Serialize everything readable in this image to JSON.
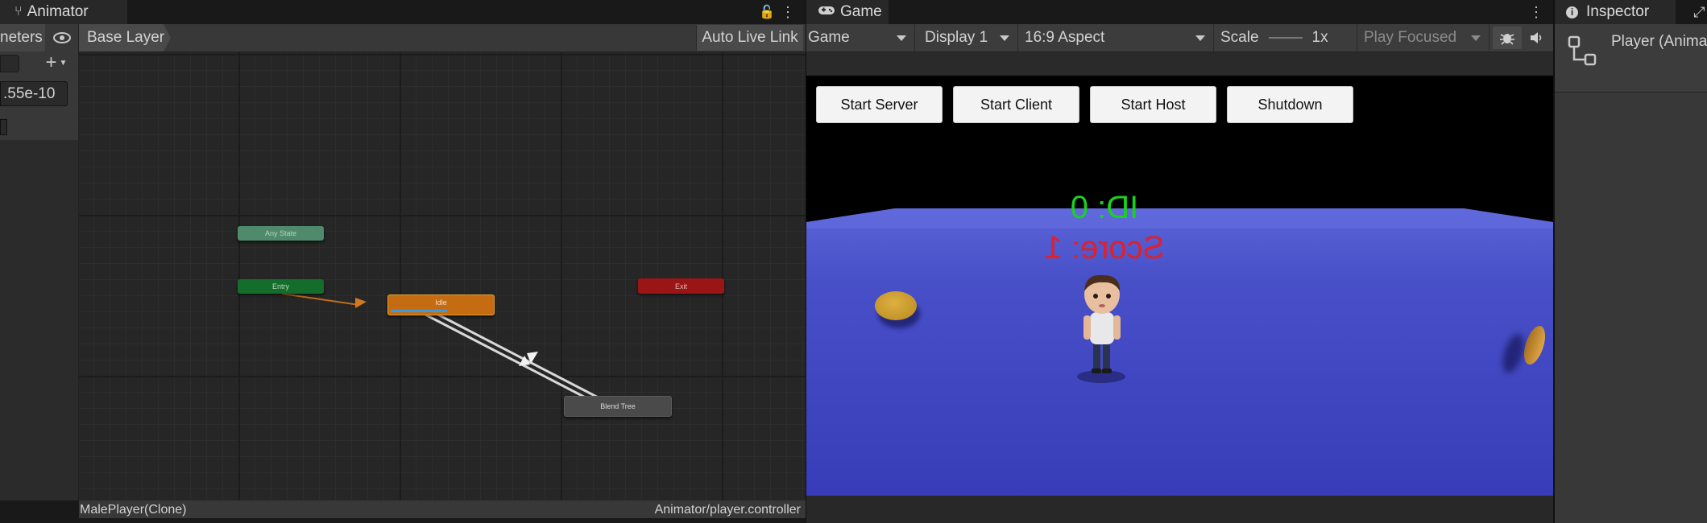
{
  "animator": {
    "tab_title": "Animator",
    "params_tab": "neters",
    "layer_label": "Base Layer",
    "auto_live_link": "Auto Live Link",
    "param_value": ".55e-10",
    "status_left": "MalePlayer(Clone)",
    "status_right": "Animator/player.controller",
    "nodes": {
      "any_state": "Any State",
      "entry": "Entry",
      "idle": "Idle",
      "exit": "Exit",
      "blend_tree": "Blend Tree"
    },
    "colors": {
      "any_state": "#4e8a6b",
      "entry": "#156d2b",
      "idle": "#c56c12",
      "exit": "#9a1616",
      "blend_tree": "#4a4a4a"
    }
  },
  "game": {
    "tab_title": "Game",
    "mode": "Game",
    "display": "Display 1",
    "aspect": "16:9 Aspect",
    "scale_label": "Scale",
    "scale_value": "1x",
    "play_mode": "Play Focused",
    "buttons": [
      "Start Server",
      "Start Client",
      "Start Host",
      "Shutdown"
    ],
    "id_text": "ID: 0",
    "score_text": "Score: 1",
    "colors": {
      "floor": "#3e46c2",
      "id_text": "#19d21e",
      "score_text": "#e0202a",
      "coin": "#c99a2c"
    }
  },
  "inspector": {
    "tab_title": "Inspector",
    "object_name": "Player (Anima"
  }
}
